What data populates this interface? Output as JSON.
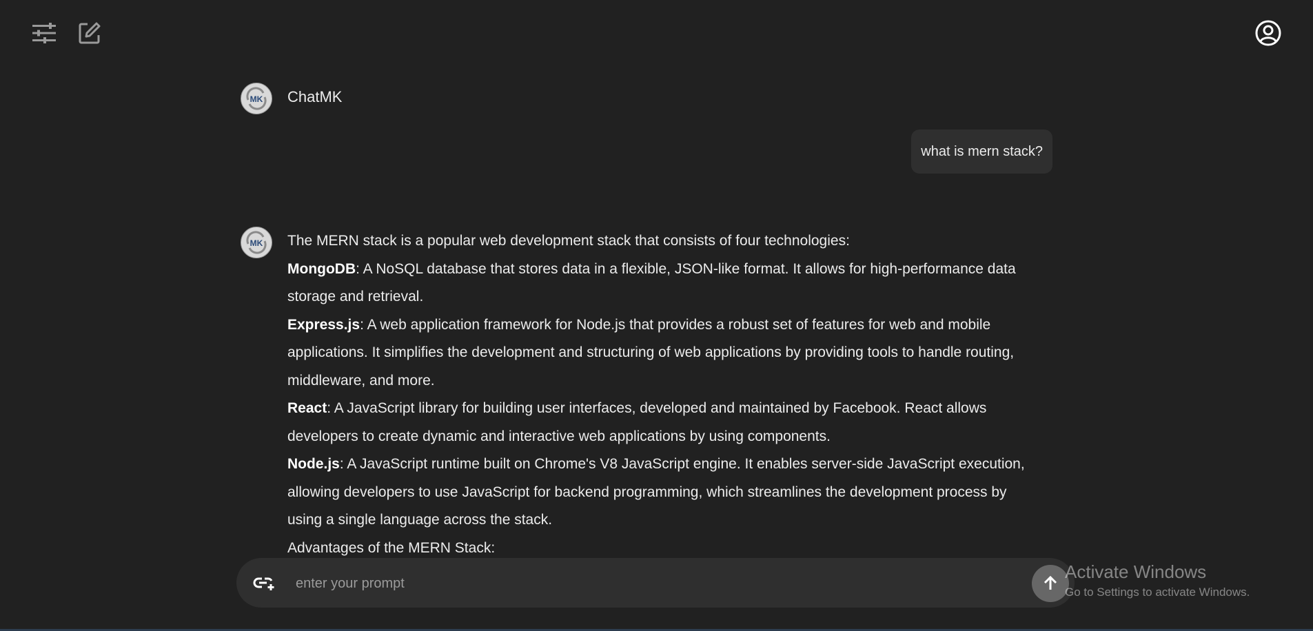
{
  "header": {
    "settings_icon": "sliders-icon",
    "new_chat_icon": "edit-icon",
    "profile_icon": "user-circle-icon"
  },
  "conversation": {
    "bot_name": "ChatMK",
    "avatar_text": "MK",
    "user_message": "what is mern stack?",
    "answer": {
      "intro": "The MERN stack is a popular web development stack that consists of four technologies:",
      "items": [
        {
          "term": "MongoDB",
          "desc": ": A NoSQL database that stores data in a flexible, JSON-like format. It allows for high-performance data storage and retrieval."
        },
        {
          "term": "Express.js",
          "desc": ": A web application framework for Node.js that provides a robust set of features for web and mobile applications. It simplifies the development and structuring of web applications by providing tools to handle routing, middleware, and more."
        },
        {
          "term": "React",
          "desc": ": A JavaScript library for building user interfaces, developed and maintained by Facebook. React allows developers to create dynamic and interactive web applications by using components."
        },
        {
          "term": "Node.js",
          "desc": ": A JavaScript runtime built on Chrome's V8 JavaScript engine. It enables server-side JavaScript execution, allowing developers to use JavaScript for backend programming, which streamlines the development process by using a single language across the stack."
        }
      ],
      "advantages_heading": "Advantages of the MERN Stack:"
    }
  },
  "prompt": {
    "placeholder": "enter your prompt",
    "attach_icon": "link-plus-icon",
    "send_icon": "arrow-up-icon"
  },
  "watermark": {
    "title": "Activate Windows",
    "subtitle": "Go to Settings to activate Windows."
  },
  "colors": {
    "background": "#212121",
    "surface": "#2f2f2f",
    "send_button": "#676767",
    "text": "#ececec",
    "placeholder": "#9b9b9b"
  }
}
